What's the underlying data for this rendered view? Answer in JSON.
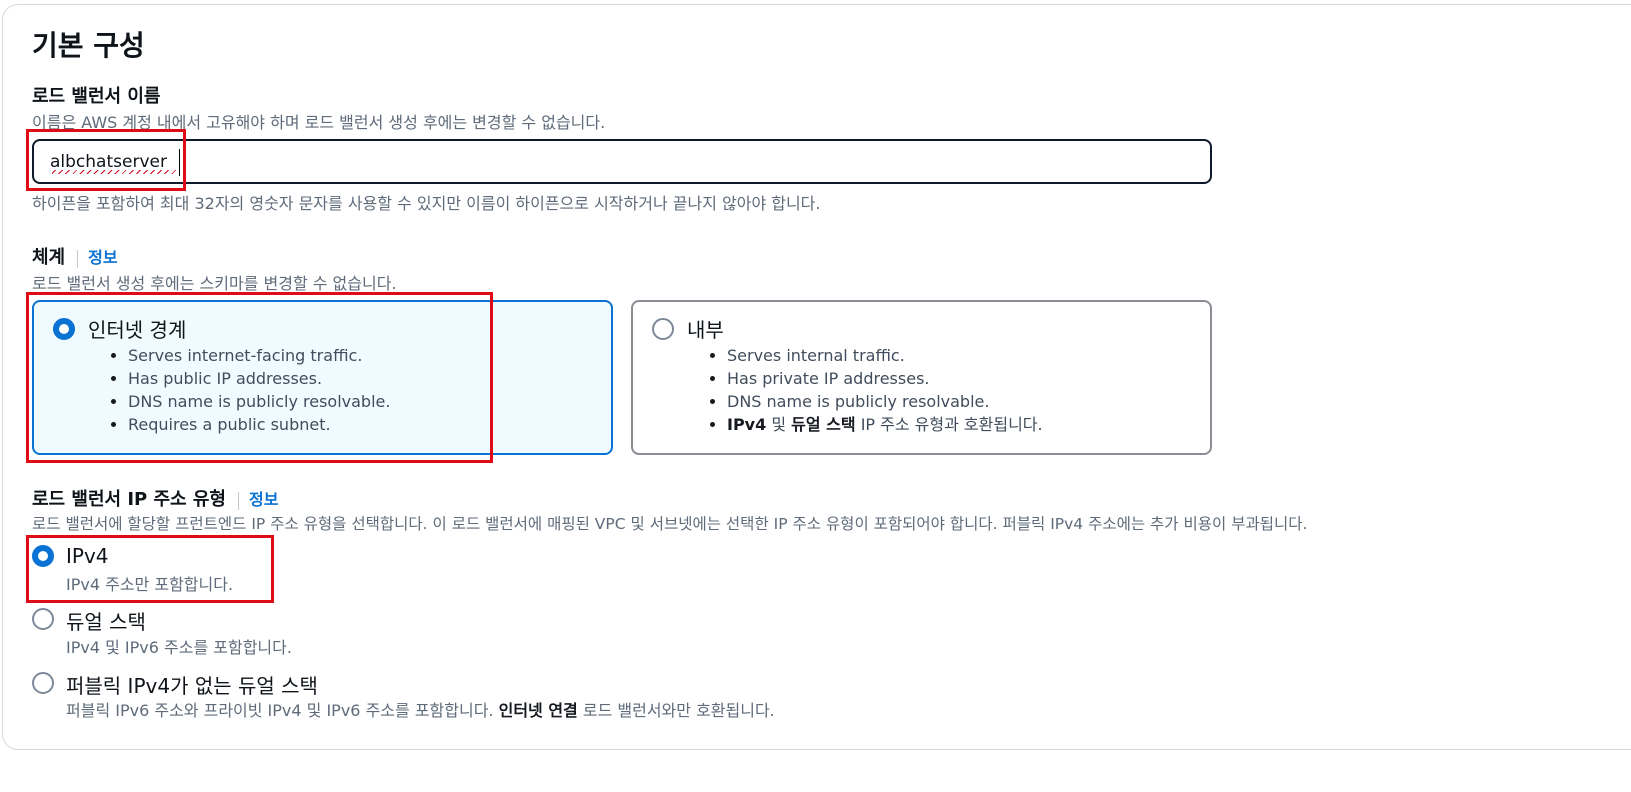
{
  "section": {
    "title": "기본 구성"
  },
  "lb_name": {
    "label": "로드 밸런서 이름",
    "description": "이름은 AWS 계정 내에서 고유해야 하며 로드 밸런서 생성 후에는 변경할 수 없습니다.",
    "value": "albchatserver",
    "constraint": "하이픈을 포함하여 최대 32자의 영숫자 문자를 사용할 수 있지만 이름이 하이픈으로 시작하거나 끝나지 않아야 합니다."
  },
  "scheme": {
    "label": "체계",
    "info": "정보",
    "description": "로드 밸런서 생성 후에는 스키마를 변경할 수 없습니다.",
    "options": [
      {
        "title": "인터넷 경계",
        "selected": true,
        "bullets": [
          "Serves internet-facing traffic.",
          "Has public IP addresses.",
          "DNS name is publicly resolvable.",
          "Requires a public subnet."
        ]
      },
      {
        "title": "내부",
        "selected": false,
        "bullets": [
          "Serves internal traffic.",
          "Has private IP addresses.",
          "DNS name is publicly resolvable."
        ],
        "last_bullet": {
          "bold1": "IPv4",
          "mid1": " 및 ",
          "bold2": "듀얼 스택",
          "rest": " IP 주소 유형과 호환됩니다."
        }
      }
    ]
  },
  "ip_type": {
    "label": "로드 밸런서 IP 주소 유형",
    "info": "정보",
    "description": "로드 밸런서에 할당할 프런트엔드 IP 주소 유형을 선택합니다. 이 로드 밸런서에 매핑된 VPC 및 서브넷에는 선택한 IP 주소 유형이 포함되어야 합니다. 퍼블릭 IPv4 주소에는 추가 비용이 부과됩니다.",
    "options": [
      {
        "title": "IPv4",
        "desc": "IPv4 주소만 포함합니다.",
        "selected": true
      },
      {
        "title": "듀얼 스택",
        "desc": "IPv4 및 IPv6 주소를 포함합니다.",
        "selected": false
      },
      {
        "title": "퍼블릭 IPv4가 없는 듀얼 스택",
        "desc_pre": "퍼블릭 IPv6 주소와 프라이빗 IPv4 및 IPv6 주소를 포함합니다. ",
        "desc_bold": "인터넷 연결",
        "desc_post": " 로드 밸런서와만 호환됩니다.",
        "selected": false
      }
    ]
  },
  "colors": {
    "accent": "#0972d3",
    "highlight_box": "#e00b16",
    "input_border": "#0f1b2a"
  }
}
